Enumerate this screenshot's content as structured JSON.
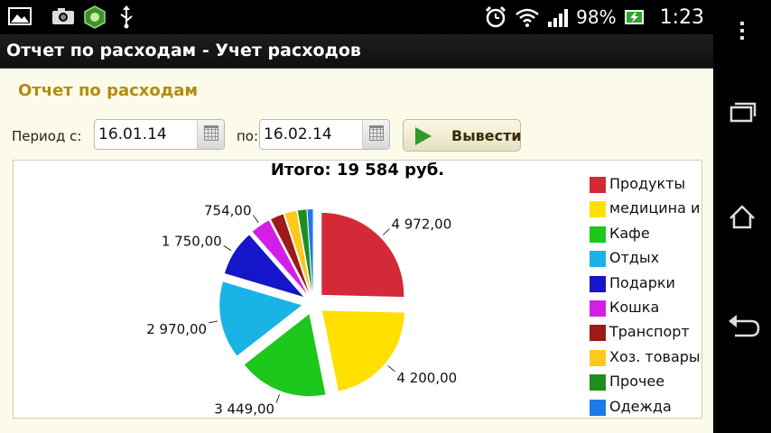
{
  "status": {
    "battery_pct": "98%",
    "time": "1:23",
    "left_icons": [
      "image-icon",
      "camera-icon",
      "app-icon",
      "usb-icon"
    ],
    "right_icons": [
      "alarm-icon",
      "wifi-icon",
      "signal-icon",
      "battery-charging-icon"
    ]
  },
  "titlebar": {
    "title": "Отчет по расходам - Учет расходов"
  },
  "report": {
    "heading": "Отчет по расходам",
    "period_from_label": "Период с:",
    "period_from_value": "16.01.14",
    "period_to_label": "по:",
    "period_to_value": "16.02.14",
    "output_button": "Вывести"
  },
  "chart_data": {
    "type": "pie",
    "title": "Итого: 19 584 руб.",
    "total": 19584,
    "legend_placement": "right",
    "slices": [
      {
        "name": "Продукты",
        "value": 4972,
        "label": "4 972,00",
        "color": "#d42a37"
      },
      {
        "name": "медицина и",
        "value": 4200,
        "label": "4 200,00",
        "color": "#ffe000"
      },
      {
        "name": "Кафе",
        "value": 3449,
        "label": "3 449,00",
        "color": "#1dc71b"
      },
      {
        "name": "Отдых",
        "value": 2970,
        "label": "2 970,00",
        "color": "#1ab3e6"
      },
      {
        "name": "Подарки",
        "value": 1750,
        "label": "1 750,00",
        "color": "#1515c9"
      },
      {
        "name": "Кошка",
        "value": 754,
        "label": "754,00",
        "color": "#d41ee8"
      },
      {
        "name": "Транспорт",
        "value": 500,
        "label": "",
        "color": "#9c1a1a"
      },
      {
        "name": "Хоз. товары",
        "value": 450,
        "label": "",
        "color": "#ffc81e"
      },
      {
        "name": "Прочее",
        "value": 330,
        "label": "",
        "color": "#1e8f1e"
      },
      {
        "name": "Одежда",
        "value": 209,
        "label": "",
        "color": "#1e7ae6"
      }
    ]
  },
  "navbar": {
    "icons": [
      "recent-apps-icon",
      "home-icon",
      "back-icon",
      "overflow-menu-icon"
    ]
  }
}
